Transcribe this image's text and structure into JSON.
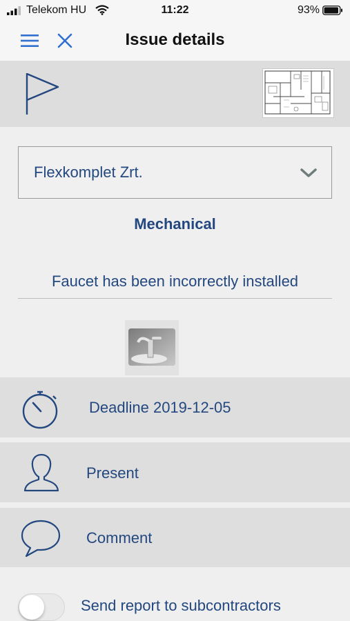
{
  "status_bar": {
    "carrier": "Telekom HU",
    "time": "11:22",
    "battery_percent": "93%"
  },
  "nav": {
    "title": "Issue details",
    "menu_icon": "hamburger-menu-icon",
    "close_icon": "close-icon"
  },
  "header": {
    "flag_icon": "flag-icon",
    "floorplan_thumbnail": "floor-plan-thumbnail"
  },
  "company_select": {
    "value": "Flexkomplet Zrt.",
    "icon": "chevron-down-icon"
  },
  "issue": {
    "category": "Mechanical",
    "description": "Faucet has been incorrectly installed",
    "photo": "faucet-photo-thumbnail"
  },
  "rows": {
    "deadline": {
      "label": "Deadline  2019-12-05",
      "icon": "stopwatch-icon"
    },
    "present": {
      "label": "Present",
      "icon": "person-icon"
    },
    "comment": {
      "label": "Comment",
      "icon": "speech-bubble-icon"
    }
  },
  "send_report": {
    "label": "Send report to subcontractors",
    "enabled": false
  },
  "colors": {
    "accent_blue": "#2f6fd0",
    "text_navy": "#23477f",
    "band_gray": "#dddddd",
    "background": "#efefef"
  }
}
